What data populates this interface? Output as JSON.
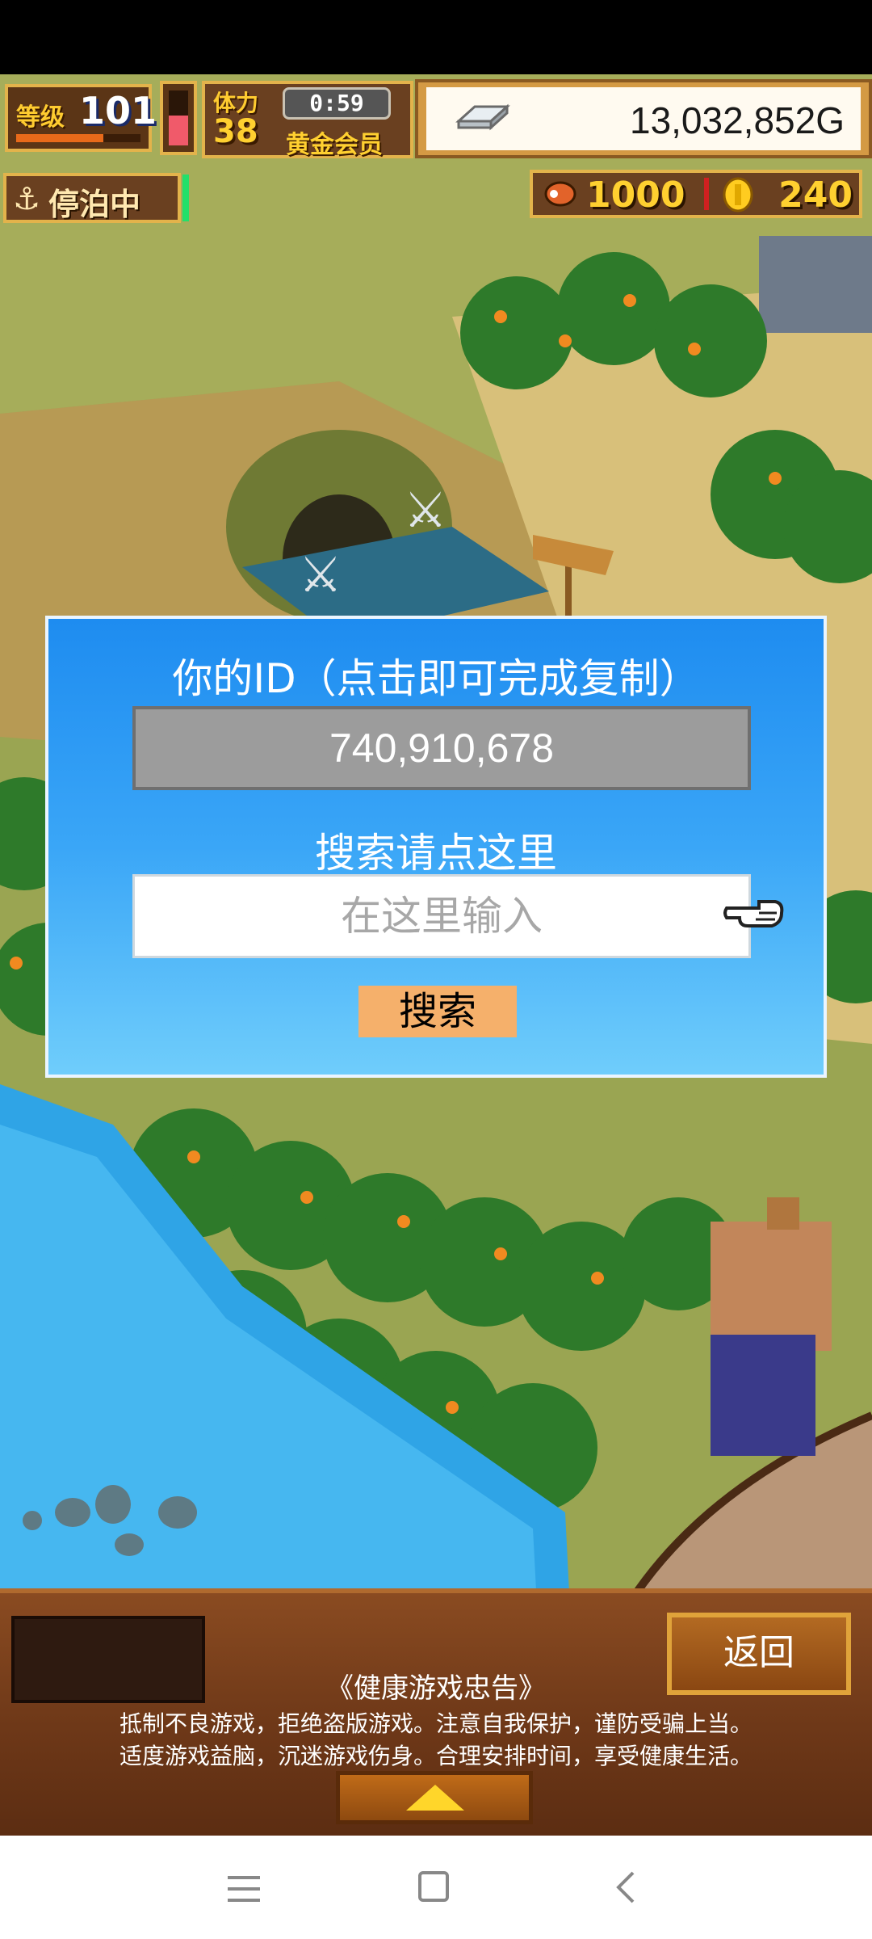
{
  "hud": {
    "level_label": "等级",
    "level_value": "101",
    "level_progress": 0.7,
    "stamina_level": 0.55,
    "hp_label": "体力",
    "hp_value": "38",
    "timer": "0:59",
    "member_label": "黄金会员",
    "money": "13,032,852G",
    "docked_label": "停泊中",
    "resource_food": "1000",
    "resource_coin": "240"
  },
  "dialog": {
    "title": "你的ID（点击即可完成复制）",
    "id_value": "740,910,678",
    "search_hint": "搜索请点这里",
    "input_placeholder": "在这里输入",
    "search_button": "搜索"
  },
  "bottom": {
    "back_button": "返回",
    "advisory_title": "《健康游戏忠告》",
    "advisory_line1": "抵制不良游戏，拒绝盗版游戏。注意自我保护，谨防受骗上当。",
    "advisory_line2": "适度游戏益脑，沉迷游戏伤身。合理安排时间，享受健康生活。"
  },
  "colors": {
    "dialog_top": "#1e8cf0",
    "dialog_bottom": "#6fcdfb",
    "id_box": "#9c9c9c",
    "search_button": "#f5b06b",
    "panel_wood": "#6e3818",
    "hud_gold": "#ffd030"
  },
  "icons": [
    "anchor-icon",
    "silver-bar-icon",
    "meat-icon",
    "coin-icon",
    "pointing-hand-icon",
    "menu-icon",
    "home-icon",
    "back-arrow-icon"
  ]
}
